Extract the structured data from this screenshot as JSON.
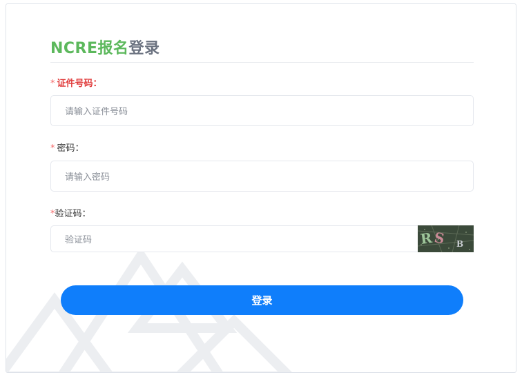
{
  "title": {
    "part1": "NCRE报名",
    "part2": "登录"
  },
  "fields": {
    "id_number": {
      "required_mark": "*",
      "label": "证件号码：",
      "placeholder": "请输入证件号码"
    },
    "password": {
      "required_mark": "*",
      "label": "密码：",
      "placeholder": "请输入密码"
    },
    "captcha": {
      "required_mark": "*",
      "label": "验证码：",
      "placeholder": "验证码",
      "image_text": "RSB"
    }
  },
  "login_button": {
    "label": "登录"
  },
  "colors": {
    "title_green": "#5cb85c",
    "title_gray": "#6b7280",
    "required_red": "#f56c6c",
    "button_blue": "#0f7efb",
    "border": "#e4e7ed"
  }
}
